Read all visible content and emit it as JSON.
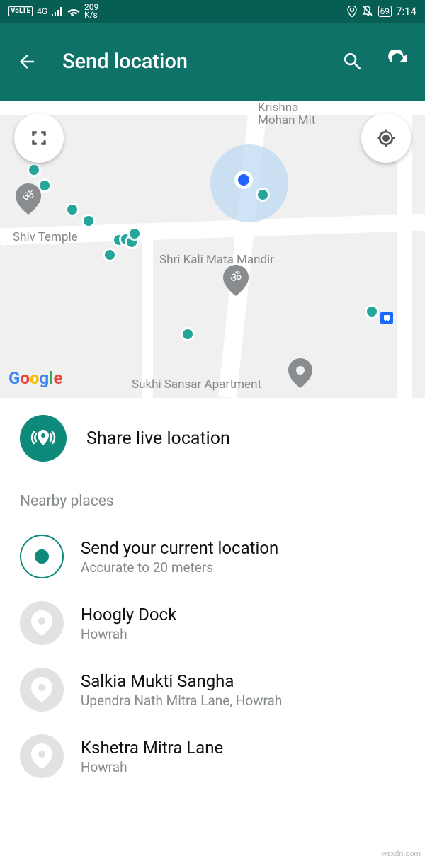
{
  "status": {
    "volte": "VoLTE",
    "net": "4G",
    "speed_value": "209",
    "speed_unit": "K/s",
    "battery": "69",
    "time": "7:14"
  },
  "appbar": {
    "title": "Send location"
  },
  "map": {
    "labels": {
      "shiv_temple": "Shiv Temple",
      "shri_kali": "Shri Kali Mata Mandir",
      "krishna": "Krishna\nMohan Mit",
      "sukhi": "Sukhi Sansar Apartment"
    },
    "logo": {
      "g1": "G",
      "g2": "o",
      "g3": "o",
      "g4": "g",
      "g5": "l",
      "g6": "e"
    }
  },
  "share": {
    "title": "Share live location"
  },
  "nearby": {
    "header": "Nearby places",
    "current": {
      "title": "Send your current location",
      "sub": "Accurate to 20 meters"
    },
    "places": [
      {
        "title": "Hoogly Dock",
        "sub": "Howrah"
      },
      {
        "title": "Salkia Mukti Sangha",
        "sub": "Upendra Nath Mitra Lane, Howrah"
      },
      {
        "title": "Kshetra Mitra Lane",
        "sub": "Howrah"
      }
    ]
  },
  "watermark": "wsxdn.com"
}
